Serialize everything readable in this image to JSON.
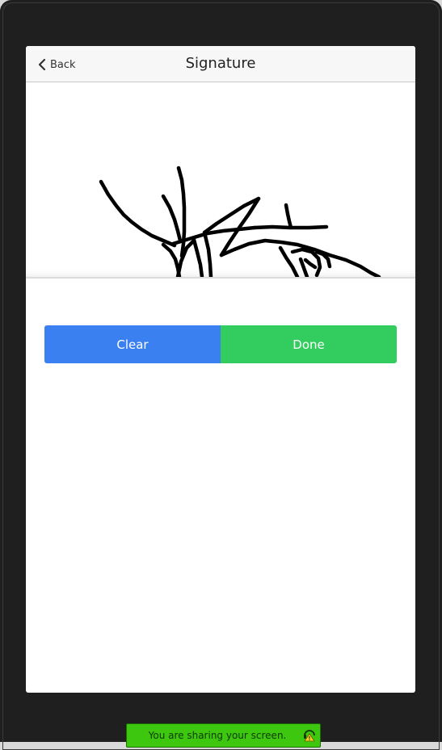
{
  "header": {
    "back_label": "Back",
    "title": "Signature"
  },
  "actions": {
    "clear_label": "Clear",
    "done_label": "Done"
  },
  "screen_share": {
    "message": "You are sharing your screen."
  },
  "colors": {
    "clear_button": "#3b80f1",
    "done_button": "#33cd5f",
    "share_bar": "#3ec70f"
  }
}
